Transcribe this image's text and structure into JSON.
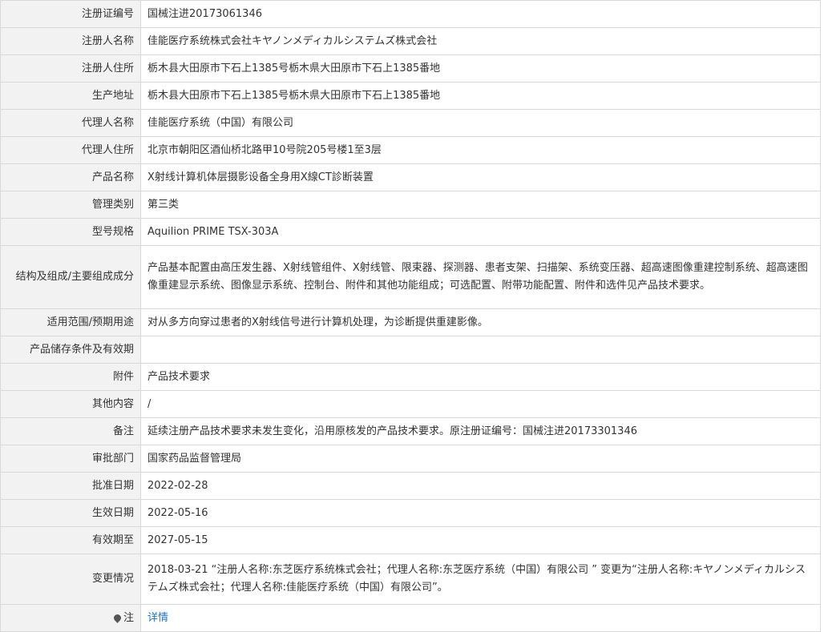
{
  "rows": [
    {
      "label": "注册证编号",
      "value": "国械注进20173061346"
    },
    {
      "label": "注册人名称",
      "value": "佳能医疗系统株式会社キヤノンメディカルシステムズ株式会社"
    },
    {
      "label": "注册人住所",
      "value": "栃木县大田原市下石上1385号栃木県大田原市下石上1385番地"
    },
    {
      "label": "生产地址",
      "value": "栃木县大田原市下石上1385号栃木県大田原市下石上1385番地"
    },
    {
      "label": "代理人名称",
      "value": "佳能医疗系统（中国）有限公司"
    },
    {
      "label": "代理人住所",
      "value": "北京市朝阳区酒仙桥北路甲10号院205号楼1至3层"
    },
    {
      "label": "产品名称",
      "value": "X射线计算机体层摄影设备全身用X線CT診断装置"
    },
    {
      "label": "管理类别",
      "value": "第三类"
    },
    {
      "label": "型号规格",
      "value": "Aquilion PRIME TSX-303A"
    },
    {
      "label": "结构及组成/主要组成成分",
      "value": "产品基本配置由高压发生器、X射线管组件、X射线管、限束器、探测器、患者支架、扫描架、系统变压器、超高速图像重建控制系统、超高速图像重建显示系统、图像显示系统、控制台、附件和其他功能组成；可选配置、附带功能配置、附件和选件见产品技术要求。"
    },
    {
      "label": "适用范围/预期用途",
      "value": "对从多方向穿过患者的X射线信号进行计算机处理，为诊断提供重建影像。"
    },
    {
      "label": "产品储存条件及有效期",
      "value": ""
    },
    {
      "label": "附件",
      "value": "产品技术要求"
    },
    {
      "label": "其他内容",
      "value": "/"
    },
    {
      "label": "备注",
      "value": "延续注册产品技术要求未发生变化，沿用原核发的产品技术要求。原注册证编号：国械注进20173301346"
    },
    {
      "label": "审批部门",
      "value": "国家药品监督管理局"
    },
    {
      "label": "批准日期",
      "value": "2022-02-28"
    },
    {
      "label": "生效日期",
      "value": "2022-05-16"
    },
    {
      "label": "有效期至",
      "value": "2027-05-15"
    },
    {
      "label": "变更情况",
      "value": "2018-03-21 “注册人名称:东芝医疗系统株式会社；代理人名称:东芝医疗系统（中国）有限公司 ” 变更为“注册人名称:キヤノンメディカルシステムズ株式会社；代理人名称:佳能医疗系统（中国）有限公司”。"
    }
  ],
  "note": {
    "label": "注",
    "icon": "map-pin-icon",
    "link_text": "详情"
  },
  "colors": {
    "label_bg": "#f2f2f2",
    "border": "#d9d9d9",
    "link": "#1a73c9"
  }
}
